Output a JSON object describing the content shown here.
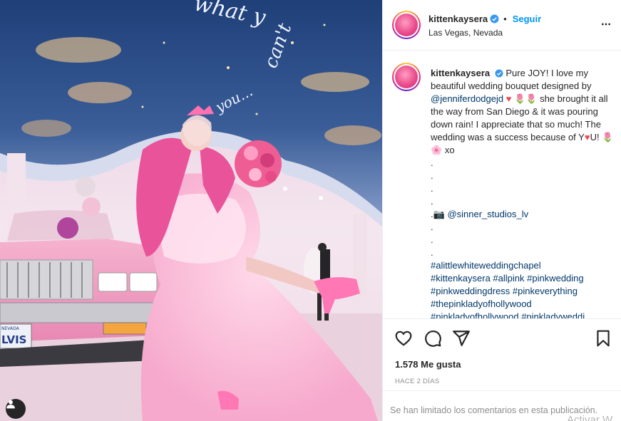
{
  "post": {
    "username": "kittenkaysera",
    "location": "Las Vegas, Nevada",
    "follow_label": "Seguir",
    "separator": "•",
    "caption": {
      "line1": "Pure JOY! I love my beautiful wedding bouquet designed by",
      "mention1": "@jenniferdodgejd",
      "line2": "she brought it all the way from San Diego & it was pouring down rain! I appreciate that so much! The wedding was a success because of Y",
      "line2b": "U!",
      "line3": "xo",
      "dots": [
        ".",
        ".",
        ".",
        "."
      ],
      "camera": "📷",
      "mention2": "@sinner_studios_lv",
      "dots2": [
        ".",
        ".",
        "."
      ],
      "hashtags": [
        "#alittlewhiteweddingchapel",
        "#kittenkaysera #allpink #pinkwedding",
        "#pinkweddingdress #pinkeverything",
        "#thepinkladyofhollywood",
        "#pinkladyofhollywood #pinkladyweddi..."
      ]
    },
    "likes": "1.578 Me gusta",
    "time": "HACE 2 DÍAS",
    "comments_limited": "Se han limitado los comentarios en esta publicación.",
    "watermark": "Activar W"
  },
  "photo": {
    "plate_text": "LVIS",
    "plate_state": "NEVADA"
  },
  "colors": {
    "link": "#00376b",
    "follow": "#0095f6",
    "verified": "#3897f0",
    "muted": "#8e8e8e"
  },
  "icons": [
    "more-options-icon",
    "heart-icon",
    "comment-icon",
    "share-icon",
    "bookmark-icon",
    "verified-badge-icon",
    "user-tag-icon"
  ]
}
